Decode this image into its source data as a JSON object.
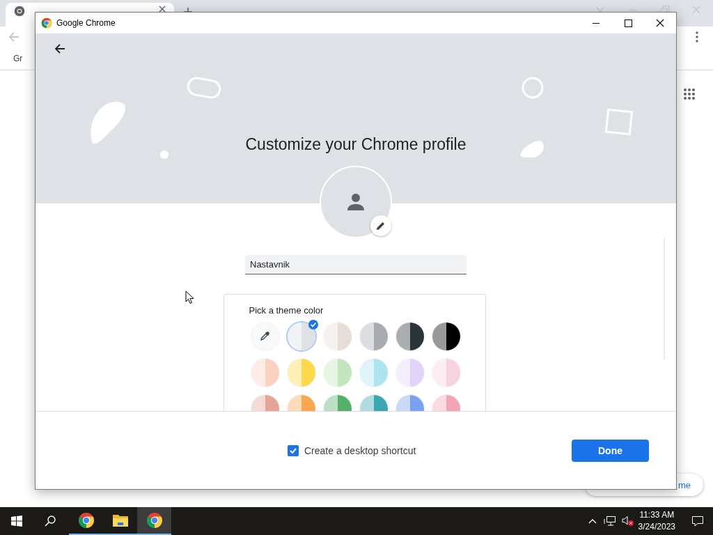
{
  "browser": {
    "bookmarks": [
      {
        "label": "Gr"
      }
    ],
    "customize_button": {
      "label": "me"
    }
  },
  "dialog": {
    "title": "Google Chrome",
    "heading": "Customize your Chrome profile",
    "name_field": {
      "value": "Nastavnik"
    },
    "theme_picker": {
      "title": "Pick a theme color",
      "swatches": [
        {
          "kind": "picker",
          "selected": false
        },
        {
          "kind": "color",
          "color": "#dee1e6",
          "selected": true
        },
        {
          "kind": "color",
          "color": "#e6ddd8",
          "selected": false
        },
        {
          "kind": "color",
          "color": "#a8abb2",
          "selected": false
        },
        {
          "kind": "color",
          "color": "#2a353b",
          "selected": false
        },
        {
          "kind": "color",
          "color": "#000000",
          "selected": false
        },
        {
          "kind": "color",
          "color": "#fbd2c0",
          "selected": false
        },
        {
          "kind": "color",
          "color": "#fdd84a",
          "selected": false
        },
        {
          "kind": "color",
          "color": "#c4e6bf",
          "selected": false
        },
        {
          "kind": "color",
          "color": "#aee4ef",
          "selected": false
        },
        {
          "kind": "color",
          "color": "#e2d3fb",
          "selected": false
        },
        {
          "kind": "color",
          "color": "#f7d3df",
          "selected": false
        },
        {
          "kind": "color",
          "color": "#e6a495",
          "selected": false
        },
        {
          "kind": "color",
          "color": "#fca64f",
          "selected": false
        },
        {
          "kind": "color",
          "color": "#55b06a",
          "selected": false
        },
        {
          "kind": "color",
          "color": "#3aa6b4",
          "selected": false
        },
        {
          "kind": "color",
          "color": "#7aa0ef",
          "selected": false
        },
        {
          "kind": "color",
          "color": "#f5a3b7",
          "selected": false
        }
      ]
    },
    "shortcut": {
      "label": "Create a desktop shortcut",
      "checked": true
    },
    "done_button": {
      "label": "Done"
    }
  },
  "taskbar": {
    "apps": [
      {
        "kind": "chrome",
        "selected": false
      },
      {
        "kind": "folder",
        "selected": false
      },
      {
        "kind": "chrome",
        "selected": true
      }
    ],
    "time": "11:33 AM",
    "date": "3/24/2023"
  }
}
